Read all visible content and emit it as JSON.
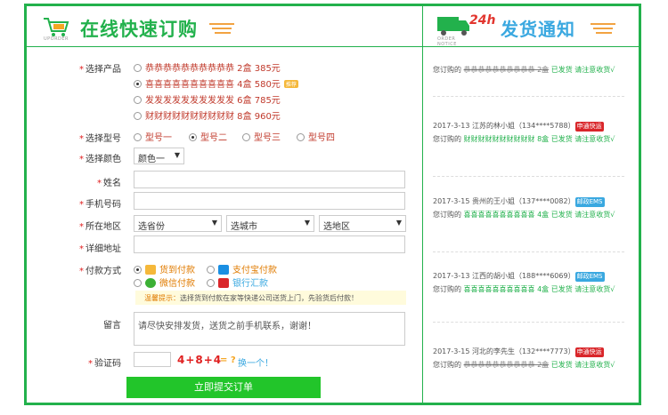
{
  "header": {
    "logo_text": "UPORDER",
    "title": "在线快速订购",
    "truck_text": "ORDER NOTICE",
    "truck_badge": "24h",
    "notice_title": "发货通知"
  },
  "form": {
    "product_label": "选择产品",
    "products": [
      {
        "name": "恭恭恭恭恭恭恭恭恭恭 2盒 385元",
        "checked": false,
        "hot": false
      },
      {
        "name": "喜喜喜喜喜喜喜喜喜喜 4盒 580元",
        "checked": true,
        "hot": true
      },
      {
        "name": "发发发发发发发发发发 6盒 785元",
        "checked": false,
        "hot": false
      },
      {
        "name": "财财财财财财财财财财 8盒 960元",
        "checked": false,
        "hot": false
      }
    ],
    "hot_badge": "推荐",
    "model_label": "选择型号",
    "models": [
      {
        "name": "型号一",
        "checked": false
      },
      {
        "name": "型号二",
        "checked": true
      },
      {
        "name": "型号三",
        "checked": false
      },
      {
        "name": "型号四",
        "checked": false
      }
    ],
    "color_label": "选择颜色",
    "color_value": "颜色一",
    "name_label": "姓名",
    "phone_label": "手机号码",
    "region_label": "所在地区",
    "province": "选省份",
    "city": "选城市",
    "district": "选地区",
    "address_label": "详细地址",
    "payment_label": "付款方式",
    "payments": [
      {
        "name": "货到付款",
        "checked": true
      },
      {
        "name": "支付宝付款",
        "checked": false
      },
      {
        "name": "微信付款",
        "checked": false
      },
      {
        "name": "银行汇款",
        "checked": false
      }
    ],
    "tip_key": "温馨提示：",
    "tip_text": "选择货到付款在家等快递公司送货上门，先验货后付款！",
    "message_label": "留言",
    "message_value": "请尽快安排发货，送货之前手机联系，谢谢！",
    "captcha_label": "验证码",
    "captcha_expr": "4+8+4",
    "captcha_q": "= ?",
    "captcha_refresh": "换一个！",
    "submit_label": "立即提交订单"
  },
  "feed": [
    {
      "date": "",
      "who": "",
      "carrier": "",
      "carrier_color": "",
      "prefix": "您订购的",
      "product": "恭恭恭恭恭恭恭恭恭恭 2盒",
      "status": "已发货 请注意收货√"
    },
    {
      "date": "2017-3-13",
      "who": "江苏的林小姐（134****5788）",
      "carrier": "申通快运",
      "carrier_color": "red",
      "prefix": "您订购的",
      "product": "财财财财财财财财财财 8盒",
      "status": "已发货 请注意收货√"
    },
    {
      "date": "2017-3-15",
      "who": "贵州的王小姐（137****0082）",
      "carrier": "邮政EMS",
      "carrier_color": "blue",
      "prefix": "您订购的",
      "product": "喜喜喜喜喜喜喜喜喜喜 4盒",
      "status": "已发货 请注意收货√"
    },
    {
      "date": "2017-3-13",
      "who": "江西的胡小姐（188****6069）",
      "carrier": "邮政EMS",
      "carrier_color": "blue",
      "prefix": "您订购的",
      "product": "喜喜喜喜喜喜喜喜喜喜 4盒",
      "status": "已发货 请注意收货√"
    },
    {
      "date": "2017-3-15",
      "who": "河北的李先生（132****7773）",
      "carrier": "申通快运",
      "carrier_color": "red",
      "prefix": "您订购的",
      "product": "恭恭恭恭恭恭恭恭恭恭 2盒",
      "status": "已发货 请注意收货√"
    }
  ]
}
